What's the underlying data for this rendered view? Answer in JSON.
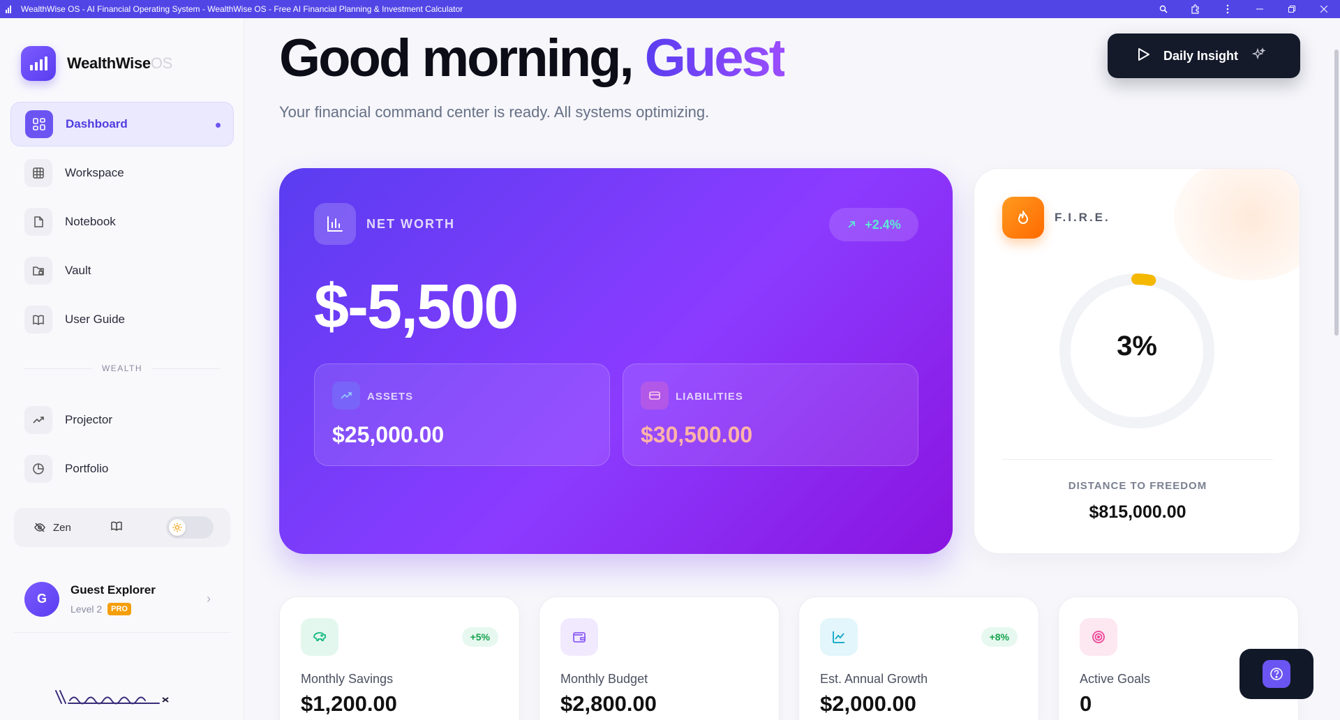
{
  "window": {
    "title": "WealthWise OS - AI Financial Operating System - WealthWise OS - Free AI Financial Planning & Investment Calculator"
  },
  "brand": {
    "name": "WealthWise",
    "suffix": "OS"
  },
  "sidebar": {
    "items": [
      {
        "label": "Dashboard",
        "icon": "grid-icon",
        "active": true
      },
      {
        "label": "Workspace",
        "icon": "table-icon"
      },
      {
        "label": "Notebook",
        "icon": "document-icon"
      },
      {
        "label": "Vault",
        "icon": "folder-lock-icon"
      },
      {
        "label": "User Guide",
        "icon": "book-icon"
      }
    ],
    "section_label": "WEALTH",
    "wealth_items": [
      {
        "label": "Projector",
        "icon": "trend-up-icon"
      },
      {
        "label": "Portfolio",
        "icon": "pie-chart-icon"
      }
    ],
    "zen_label": "Zen"
  },
  "profile": {
    "initial": "G",
    "name": "Guest Explorer",
    "level": "Level 2",
    "badge": "PRO"
  },
  "signature": "\\\\strategla-x",
  "header": {
    "greeting": "Good morning,",
    "name": "Guest",
    "subtitle": "Your financial command center is ready. All systems optimizing.",
    "insight_button": "Daily Insight"
  },
  "net_worth": {
    "label": "NET WORTH",
    "change": "+2.4%",
    "value": "$-5,500",
    "assets_label": "ASSETS",
    "assets_value": "$25,000.00",
    "liabilities_label": "LIABILITIES",
    "liabilities_value": "$30,500.00"
  },
  "fire": {
    "label": "F.I.R.E.",
    "percent_text": "3%",
    "progress": 0.03,
    "distance_label": "DISTANCE TO FREEDOM",
    "distance_value": "$815,000.00"
  },
  "stats": [
    {
      "label": "Monthly Savings",
      "value": "$1,200.00",
      "badge": "+5%",
      "icon": "piggy-bank-icon"
    },
    {
      "label": "Monthly Budget",
      "value": "$2,800.00",
      "badge": "",
      "icon": "wallet-icon"
    },
    {
      "label": "Est. Annual Growth",
      "value": "$2,000.00",
      "badge": "+8%",
      "icon": "line-chart-icon"
    },
    {
      "label": "Active Goals",
      "value": "0",
      "badge": "",
      "icon": "target-icon"
    }
  ],
  "colors": {
    "accent": "#6b55f2",
    "titlebar": "#5145e6",
    "positive": "#16a34a",
    "fire_orange": "#ff7a00",
    "liabilities": "#ffb4a8"
  }
}
